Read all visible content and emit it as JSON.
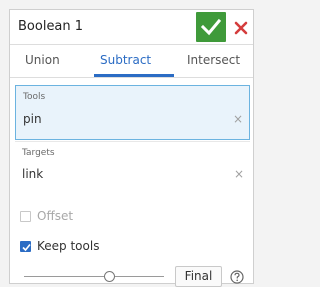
{
  "dialog": {
    "title": "Boolean 1",
    "accept_icon": "checkmark-icon",
    "close_icon": "close-icon",
    "accept_color": "#3f9a3a",
    "close_color": "#d43c3c"
  },
  "tabs": [
    {
      "label": "Union",
      "active": false
    },
    {
      "label": "Subtract",
      "active": true
    },
    {
      "label": "Intersect",
      "active": false
    }
  ],
  "accent_color": "#2b6cc4",
  "fields": {
    "tools": {
      "label": "Tools",
      "value": "pin",
      "clear_icon": "×"
    },
    "targets": {
      "label": "Targets",
      "value": "link",
      "clear_icon": "×"
    }
  },
  "options": {
    "offset": {
      "label": "Offset",
      "checked": false,
      "enabled": false
    },
    "keep_tools": {
      "label": "Keep tools",
      "checked": true,
      "enabled": true
    }
  },
  "footer": {
    "slider_value": 0.62,
    "final_label": "Final",
    "help_icon": "help-icon"
  }
}
